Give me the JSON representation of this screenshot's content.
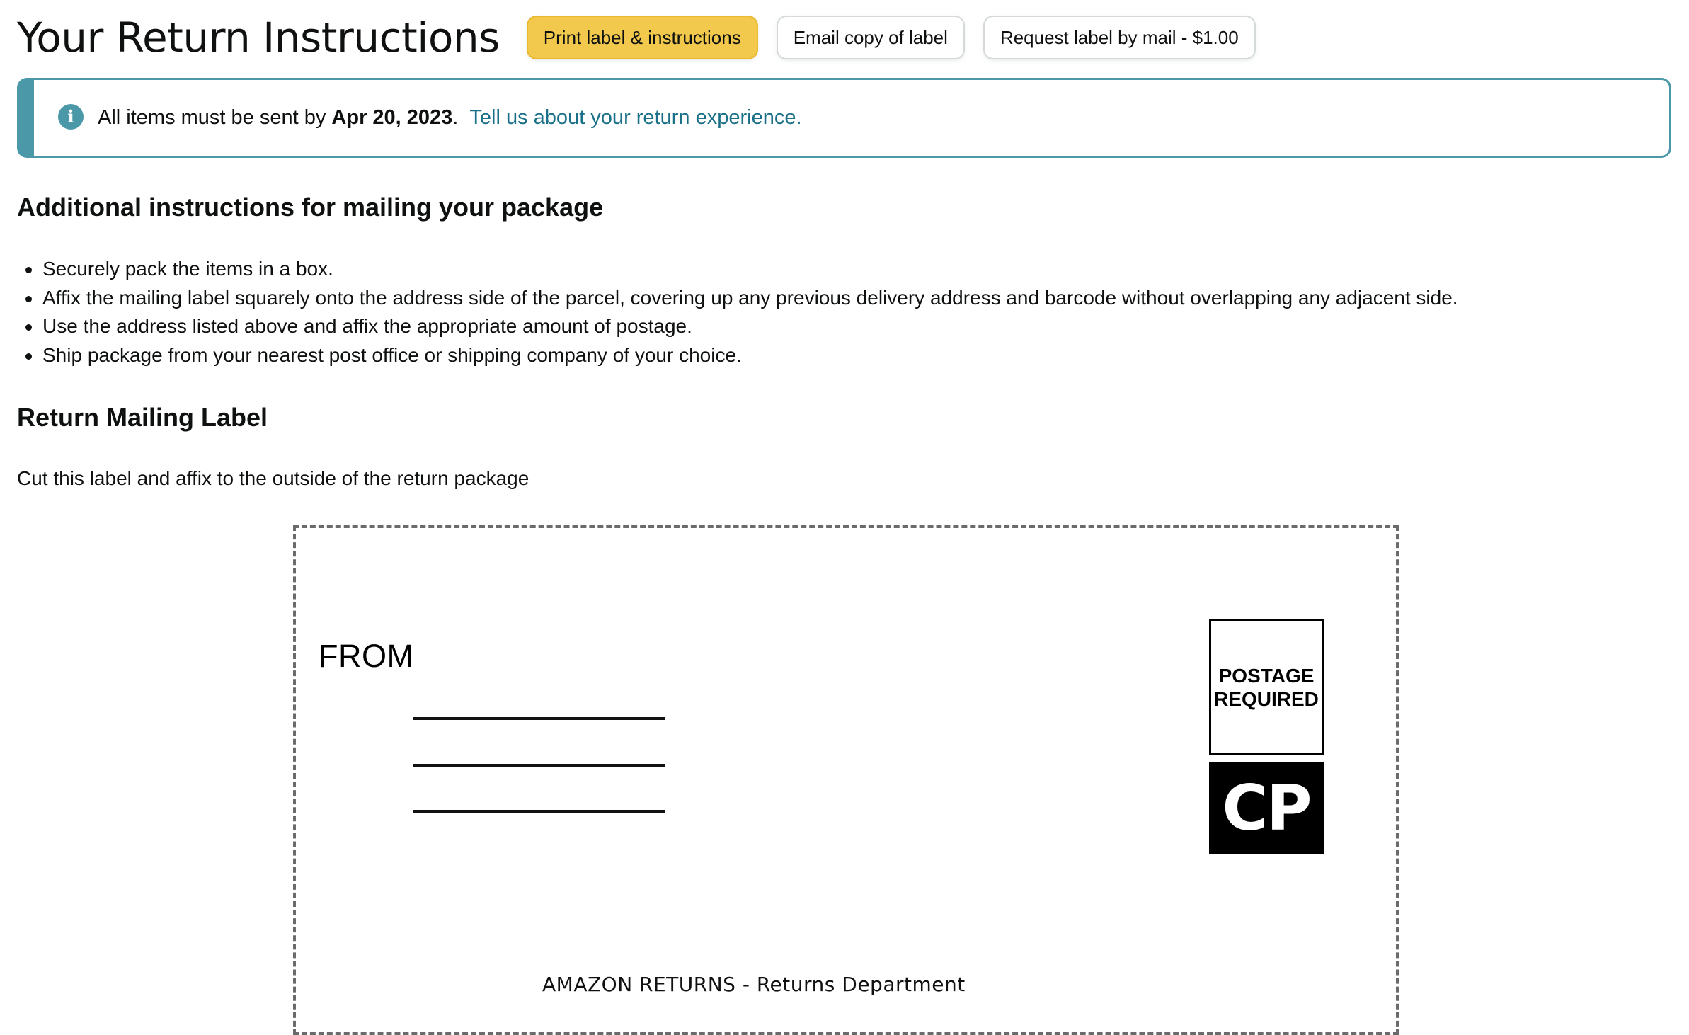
{
  "header": {
    "title": "Your Return Instructions",
    "buttons": {
      "print": "Print label & instructions",
      "email": "Email copy of label",
      "request_mail": "Request label by mail - $1.00"
    }
  },
  "alert": {
    "icon": "info-icon",
    "glyph": "i",
    "prefix": "All items must be sent by",
    "date": "Apr 20, 2023",
    "suffix": ".",
    "link": "Tell us about your return experience."
  },
  "mailing_instructions": {
    "heading": "Additional instructions for mailing your package",
    "items": [
      "Securely pack the items in a box.",
      "Affix the mailing label squarely onto the address side of the parcel, covering up any previous delivery address and barcode without overlapping any adjacent side.",
      "Use the address listed above and affix the appropriate amount of postage.",
      "Ship package from your nearest post office or shipping company of your choice."
    ]
  },
  "return_label": {
    "heading": "Return Mailing Label",
    "cut_text": "Cut this label and affix to the outside of the return package",
    "from": "FROM",
    "postage_line1": "POSTAGE",
    "postage_line2": "REQUIRED",
    "carrier_logo": "CP",
    "to_address": "AMAZON RETURNS - Returns Department"
  },
  "colors": {
    "primary_button": "#f2c94c",
    "alert_accent": "#4a98a8",
    "link": "#1a7088"
  }
}
